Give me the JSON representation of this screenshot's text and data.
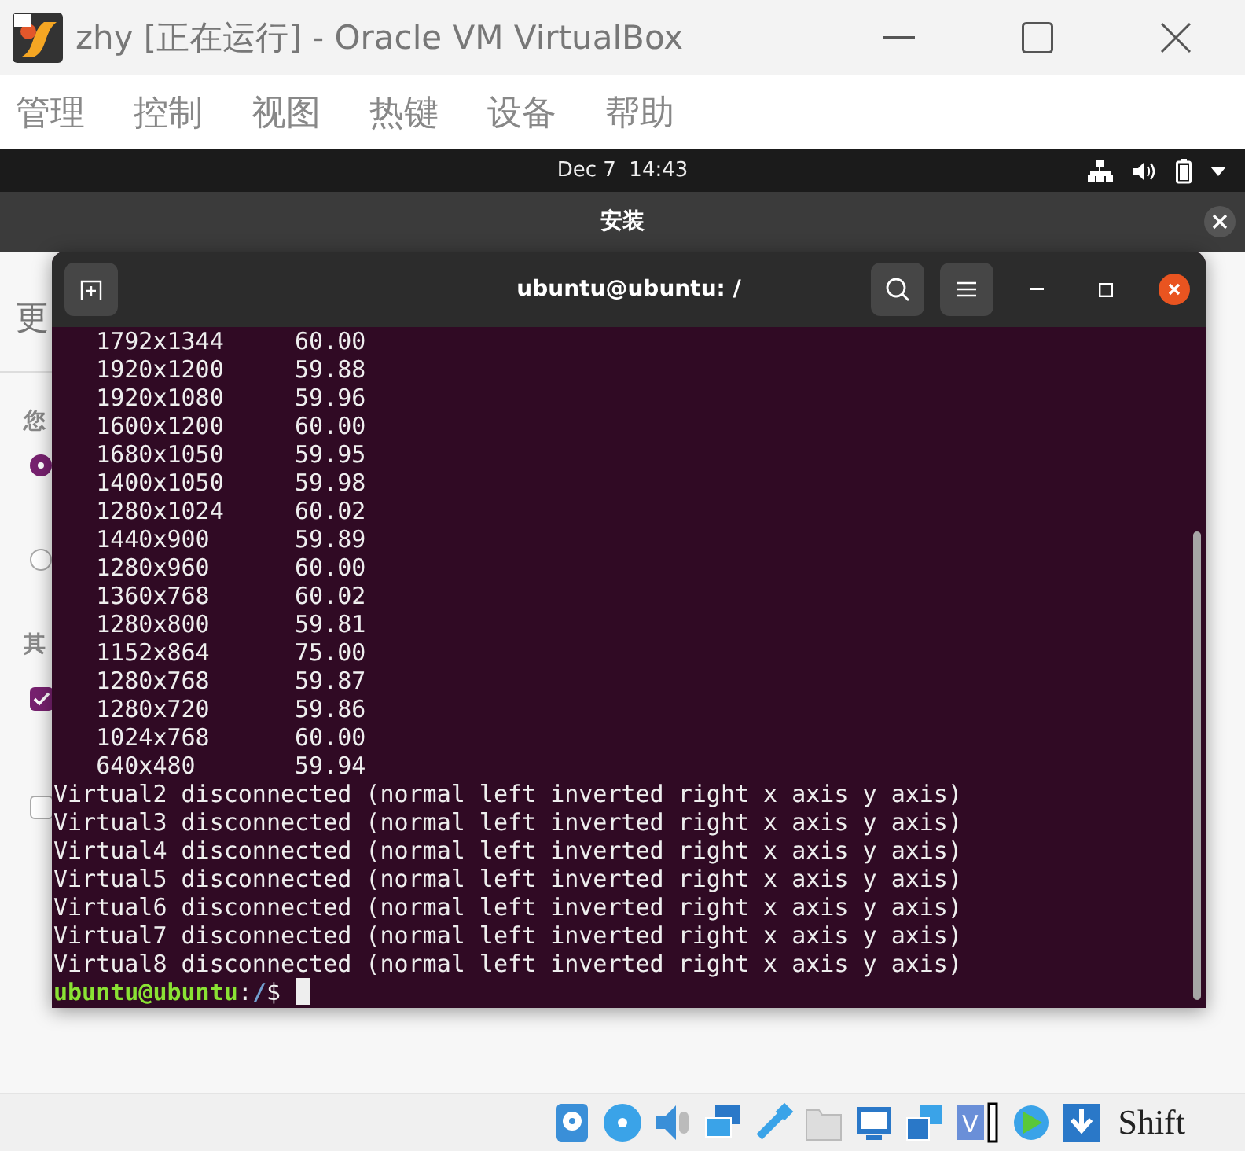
{
  "window": {
    "title": "zhy [正在运行] - Oracle VM VirtualBox"
  },
  "menu": [
    "管理",
    "控制",
    "视图",
    "热键",
    "设备",
    "帮助"
  ],
  "top_bar": {
    "clock": "Dec 7  14:43"
  },
  "installer": {
    "title": "安装",
    "heading": "更",
    "section_1": "您",
    "options": [
      {
        "selected": true
      },
      {
        "selected": false
      }
    ],
    "section_2": "其",
    "checkboxes": [
      {
        "checked": true
      },
      {
        "checked": false
      }
    ]
  },
  "terminal": {
    "title": "ubuntu@ubuntu: /",
    "lines": [
      {
        "kind": "mode",
        "resolution": "1792x1344",
        "rate": "60.00"
      },
      {
        "kind": "mode",
        "resolution": "1920x1200",
        "rate": "59.88"
      },
      {
        "kind": "mode",
        "resolution": "1920x1080",
        "rate": "59.96"
      },
      {
        "kind": "mode",
        "resolution": "1600x1200",
        "rate": "60.00"
      },
      {
        "kind": "mode",
        "resolution": "1680x1050",
        "rate": "59.95"
      },
      {
        "kind": "mode",
        "resolution": "1400x1050",
        "rate": "59.98"
      },
      {
        "kind": "mode",
        "resolution": "1280x1024",
        "rate": "60.02"
      },
      {
        "kind": "mode",
        "resolution": "1440x900",
        "rate": "59.89"
      },
      {
        "kind": "mode",
        "resolution": "1280x960",
        "rate": "60.00"
      },
      {
        "kind": "mode",
        "resolution": "1360x768",
        "rate": "60.02"
      },
      {
        "kind": "mode",
        "resolution": "1280x800",
        "rate": "59.81"
      },
      {
        "kind": "mode",
        "resolution": "1152x864",
        "rate": "75.00"
      },
      {
        "kind": "mode",
        "resolution": "1280x768",
        "rate": "59.87"
      },
      {
        "kind": "mode",
        "resolution": "1280x720",
        "rate": "59.86"
      },
      {
        "kind": "mode",
        "resolution": "1024x768",
        "rate": "60.00"
      },
      {
        "kind": "mode",
        "resolution": "640x480",
        "rate": "59.94"
      },
      {
        "kind": "output",
        "text": "Virtual2 disconnected (normal left inverted right x axis y axis)"
      },
      {
        "kind": "output",
        "text": "Virtual3 disconnected (normal left inverted right x axis y axis)"
      },
      {
        "kind": "output",
        "text": "Virtual4 disconnected (normal left inverted right x axis y axis)"
      },
      {
        "kind": "output",
        "text": "Virtual5 disconnected (normal left inverted right x axis y axis)"
      },
      {
        "kind": "output",
        "text": "Virtual6 disconnected (normal left inverted right x axis y axis)"
      },
      {
        "kind": "output",
        "text": "Virtual7 disconnected (normal left inverted right x axis y axis)"
      },
      {
        "kind": "output",
        "text": "Virtual8 disconnected (normal left inverted right x axis y axis)"
      }
    ],
    "prompt": {
      "user": "ubuntu@ubuntu",
      "separator": ":",
      "path": "/",
      "symbol": "$"
    }
  },
  "status_bar": {
    "chip_label": "V",
    "host_key": "Shift"
  }
}
